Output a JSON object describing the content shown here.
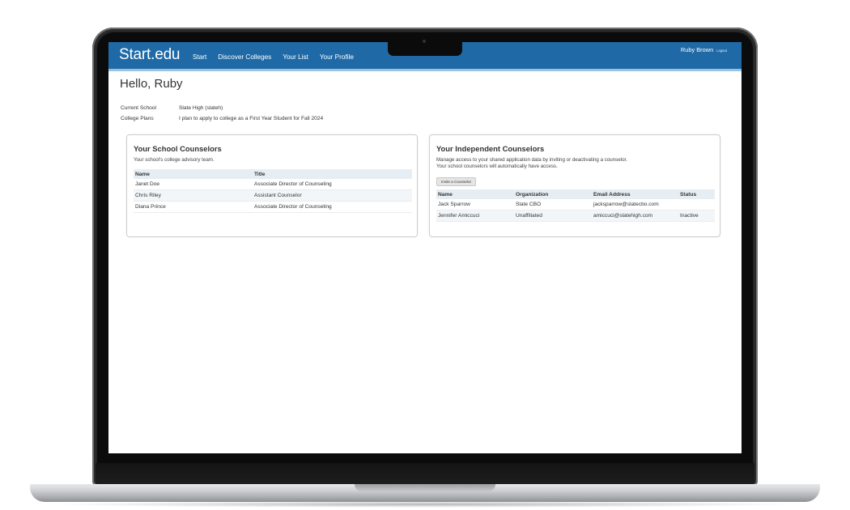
{
  "app": {
    "brand": "Start.edu",
    "nav": [
      "Start",
      "Discover Colleges",
      "Your List",
      "Your Profile"
    ],
    "user_name": "Ruby Brown",
    "logout_label": "Logout"
  },
  "greeting": "Hello, Ruby",
  "profile": {
    "current_school_label": "Current School",
    "current_school_value": "Slate High (slateh)",
    "college_plans_label": "College Plans",
    "college_plans_value": "I plan to apply to college as a First Year Student for Fall 2024"
  },
  "school_counselors": {
    "title": "Your School Counselors",
    "description": "Your school's college advisory team.",
    "headers": [
      "Name",
      "Title"
    ],
    "rows": [
      [
        "Janet Doe",
        "Associate Director of Counseling"
      ],
      [
        "Chris Riley",
        "Assistant Counselor"
      ],
      [
        "Diana Prince",
        "Associate Director of Counseling"
      ]
    ]
  },
  "independent_counselors": {
    "title": "Your Independent Counselors",
    "description_1": "Manage access to your shared application data by inviting or deactivating a counselor.",
    "description_2": "Your school counselors will automatically have access.",
    "invite_label": "Invite a Counselor",
    "headers": [
      "Name",
      "Organization",
      "Email Address",
      "Status"
    ],
    "rows": [
      [
        "Jack Sparrow",
        "Slate CBO",
        "jacksparrow@slatecbo.com",
        ""
      ],
      [
        "Jennifer Amiccuci",
        "Unaffiliated",
        "amiccuci@slatehigh.com",
        "Inactive"
      ]
    ]
  },
  "colors": {
    "topbar": "#1f6aa6",
    "table_header": "#e6eef3"
  }
}
